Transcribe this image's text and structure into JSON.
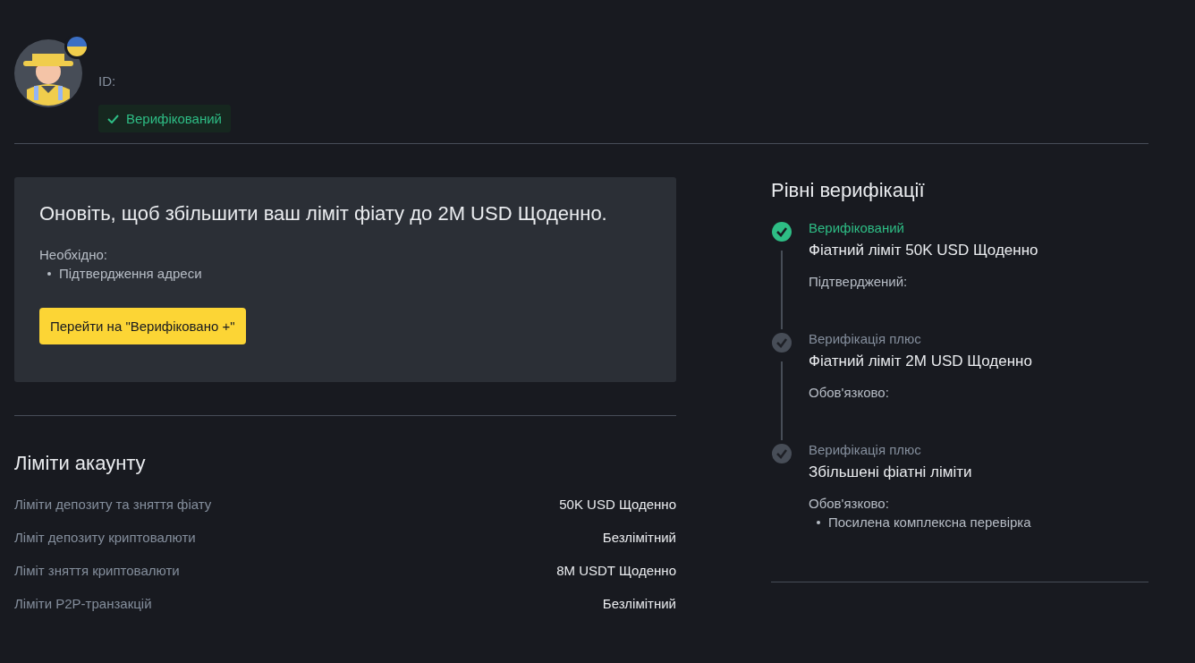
{
  "profile": {
    "id_label": "ID:",
    "badge": "Верифікований"
  },
  "upgrade": {
    "title": "Оновіть, щоб збільшити ваш ліміт фіату до 2M USD Щоденно.",
    "required_label": "Необхідно:",
    "requirements": [
      "Підтвердження адреси"
    ],
    "button": "Перейти на \"Верифіковано +\""
  },
  "limits": {
    "title": "Ліміти акаунту",
    "rows": [
      {
        "label": "Ліміти депозиту та зняття фіату",
        "value": "50K USD Щоденно"
      },
      {
        "label": "Ліміт депозиту криптовалюти",
        "value": "Безлімітний"
      },
      {
        "label": "Ліміт зняття криптовалюти",
        "value": "8M USDT Щоденно"
      },
      {
        "label": "Ліміти P2P-транзакцій",
        "value": "Безлімітний"
      }
    ]
  },
  "levels": {
    "title": "Рівні верифікації",
    "items": [
      {
        "name": "Верифікований",
        "done": true,
        "limit": "Фіатний ліміт 50K USD Щоденно",
        "note": "Підтверджений:"
      },
      {
        "name": "Верифікація плюс",
        "done": false,
        "limit": "Фіатний ліміт 2M USD Щоденно",
        "note": "Обов'язково:"
      },
      {
        "name": "Верифікація плюс",
        "done": false,
        "limit": "Збільшені фіатні ліміти",
        "note": "Обов'язково:",
        "bullets": [
          "Посилена комплексна перевірка"
        ]
      }
    ]
  }
}
